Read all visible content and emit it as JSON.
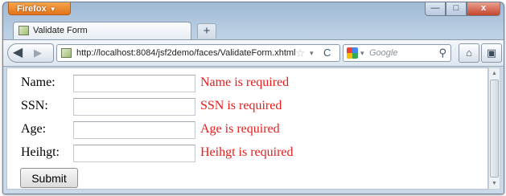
{
  "browser": {
    "menu_label": "Firefox",
    "menu_arrow": "▼",
    "window_controls": {
      "minimize": "—",
      "maximize": "□",
      "close": "x"
    },
    "tab": {
      "title": "Validate Form",
      "icon": "page-favicon"
    },
    "new_tab_label": "+",
    "nav": {
      "back_icon": "◀",
      "forward_icon": "▶",
      "url": "http://localhost:8084/jsf2demo/faces/ValidateForm.xhtml",
      "star_icon": "☆",
      "dropdown_icon": "▾",
      "reload_icon": "C",
      "search_placeholder": "Google",
      "search_dropdown_icon": "▾",
      "magnifier_icon": "⚲",
      "home_icon": "⌂",
      "bookmarks_icon": "▣"
    }
  },
  "form": {
    "fields": [
      {
        "label": "Name:",
        "value": "",
        "error": "Name is required"
      },
      {
        "label": "SSN:",
        "value": "",
        "error": "SSN is required"
      },
      {
        "label": "Age:",
        "value": "",
        "error": "Age is required"
      },
      {
        "label": "Heihgt:",
        "value": "",
        "error": "Heihgt is required"
      }
    ],
    "submit_label": "Submit",
    "error_color": "#e81b1b"
  }
}
